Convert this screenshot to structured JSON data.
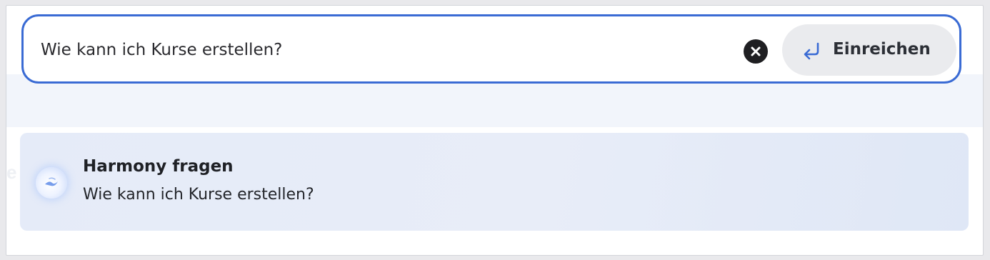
{
  "search": {
    "value": "Wie kann ich Kurse erstellen?",
    "clear_icon": "close-circle-icon",
    "submit_icon": "enter-arrow-icon",
    "submit_label": "Einreichen"
  },
  "suggestion": {
    "icon": "harmony-orb-icon",
    "title": "Harmony fragen",
    "text": "Wie kann ich Kurse erstellen?"
  },
  "colors": {
    "focus_border": "#3a6bd4",
    "accent_icon": "#3a6bd4",
    "suggestion_bg": "#e5ebf8"
  }
}
